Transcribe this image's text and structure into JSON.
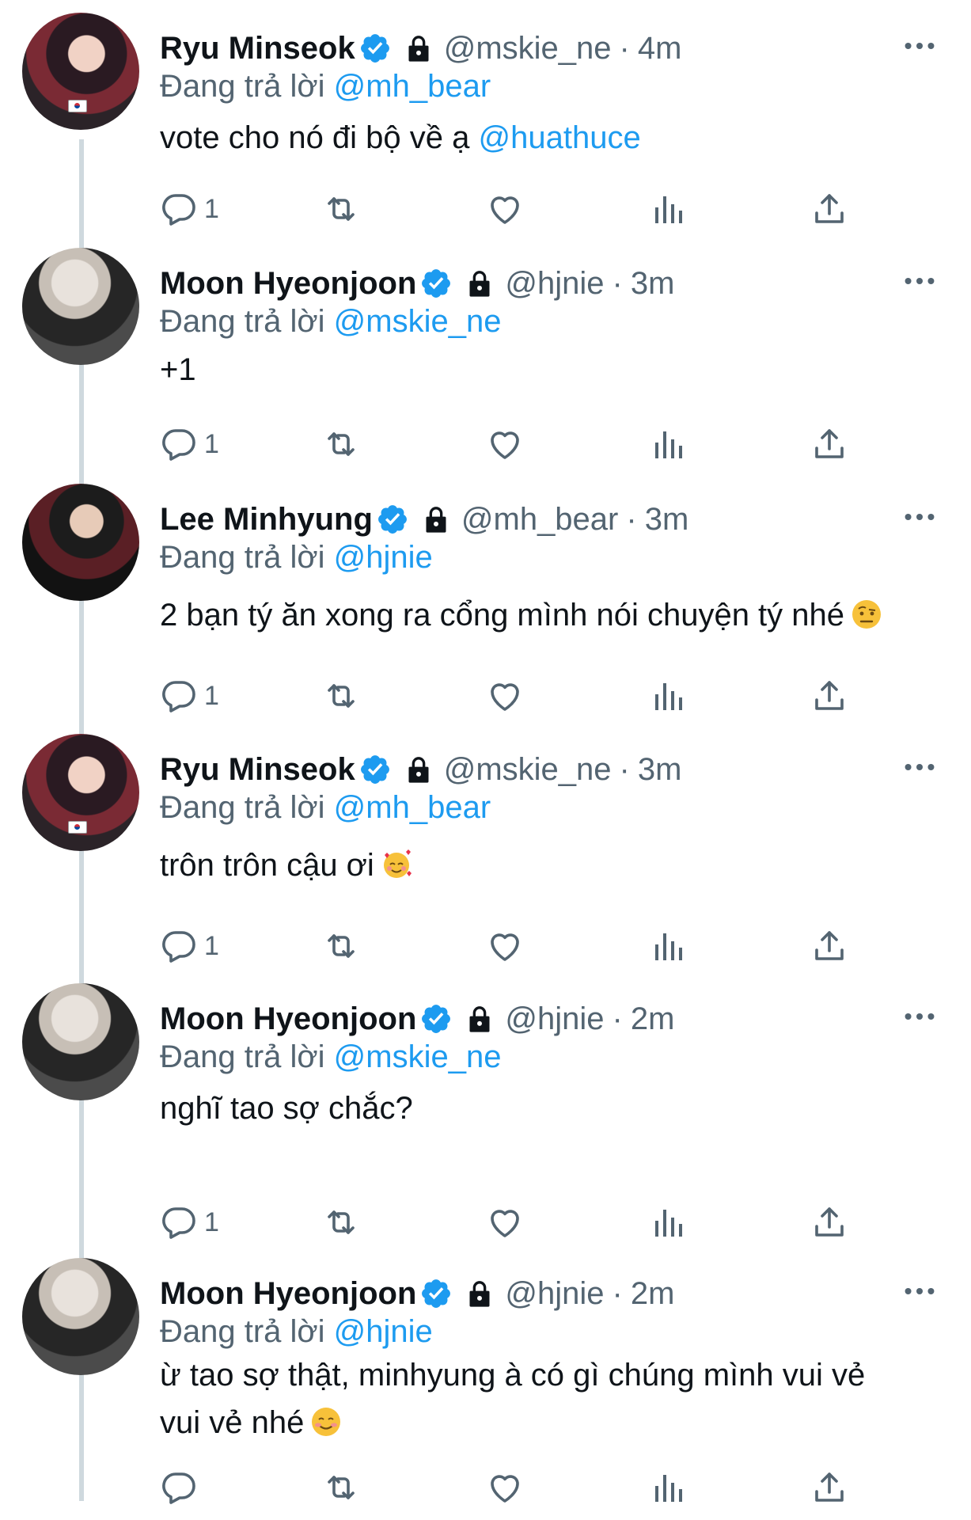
{
  "colors": {
    "link": "#1d9bf0",
    "muted": "#536471",
    "text": "#0f1419",
    "thread_line": "#cfd9de"
  },
  "replying_prefix": "Đang trả lời",
  "tweets": [
    {
      "name": "Ryu Minseok",
      "handle": "@mskie_ne",
      "time": "4m",
      "dot": "·",
      "replying_to": "@mh_bear",
      "text": "vote cho nó đi bộ về ạ ",
      "text_mention": "@huathuce",
      "reply_count": "1",
      "avatar": "ryu"
    },
    {
      "name": "Moon Hyeonjoon",
      "handle": "@hjnie",
      "time": "3m",
      "dot": "·",
      "replying_to": "@mskie_ne",
      "text": "+1",
      "reply_count": "1",
      "avatar": "moon"
    },
    {
      "name": "Lee Minhyung",
      "handle": "@mh_bear",
      "time": "3m",
      "dot": "·",
      "replying_to": "@hjnie",
      "text": "2 bạn tý ăn xong ra cổng mình nói chuyện tý nhé",
      "emoji": "face-with-raised-eyebrow",
      "reply_count": "1",
      "avatar": "lee"
    },
    {
      "name": "Ryu Minseok",
      "handle": "@mskie_ne",
      "time": "3m",
      "dot": "·",
      "replying_to": "@mh_bear",
      "text": "trôn trôn cậu ơi",
      "emoji": "smiling-face-with-hearts",
      "reply_count": "1",
      "avatar": "ryu"
    },
    {
      "name": "Moon Hyeonjoon",
      "handle": "@hjnie",
      "time": "2m",
      "dot": "·",
      "replying_to": "@mskie_ne",
      "text": "nghĩ tao sợ chắc?",
      "reply_count": "1",
      "avatar": "moon"
    },
    {
      "name": "Moon Hyeonjoon",
      "handle": "@hjnie",
      "time": "2m",
      "dot": "·",
      "replying_to": "@hjnie",
      "text_line1": "ừ tao sợ thật, minhyung à có gì chúng mình vui vẻ",
      "text_line2": "vui vẻ nhé",
      "emoji": "smiling-face",
      "reply_count": "",
      "avatar": "moon"
    }
  ]
}
